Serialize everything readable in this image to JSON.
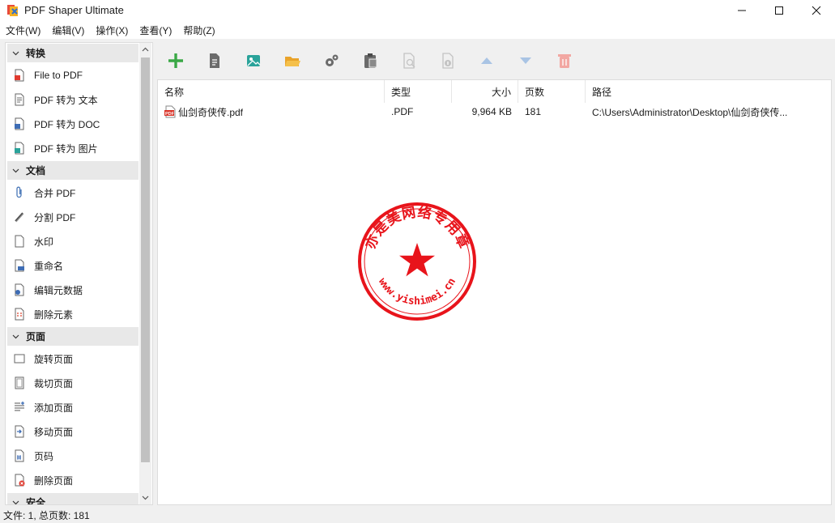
{
  "window": {
    "title": "PDF Shaper Ultimate",
    "icon": "app-icon",
    "controls": [
      "minimize-icon",
      "maximize-icon",
      "close-icon"
    ]
  },
  "menu": [
    "文件(W)",
    "编辑(V)",
    "操作(X)",
    "查看(Y)",
    "帮助(Z)"
  ],
  "sidebar": {
    "sections": [
      {
        "label": "转换",
        "items": [
          {
            "label": "File to PDF",
            "icon": "file-to-pdf-icon"
          },
          {
            "label": "PDF 转为 文本",
            "icon": "pdf-to-text-icon"
          },
          {
            "label": "PDF 转为 DOC",
            "icon": "pdf-to-doc-icon"
          },
          {
            "label": "PDF 转为 图片",
            "icon": "pdf-to-image-icon"
          }
        ]
      },
      {
        "label": "文档",
        "items": [
          {
            "label": "合并 PDF",
            "icon": "paperclip-icon"
          },
          {
            "label": "分割 PDF",
            "icon": "split-icon"
          },
          {
            "label": "水印",
            "icon": "watermark-icon"
          },
          {
            "label": "重命名",
            "icon": "rename-icon"
          },
          {
            "label": "编辑元数据",
            "icon": "metadata-icon"
          },
          {
            "label": "删除元素",
            "icon": "remove-elements-icon"
          }
        ]
      },
      {
        "label": "页面",
        "items": [
          {
            "label": "旋转页面",
            "icon": "rotate-page-icon"
          },
          {
            "label": "裁切页面",
            "icon": "crop-page-icon"
          },
          {
            "label": "添加页面",
            "icon": "add-page-icon"
          },
          {
            "label": "移动页面",
            "icon": "move-page-icon"
          },
          {
            "label": "页码",
            "icon": "page-number-icon"
          },
          {
            "label": "删除页面",
            "icon": "delete-page-icon"
          }
        ]
      },
      {
        "label": "安全",
        "items": []
      }
    ]
  },
  "toolbar": [
    "add-icon",
    "document-icon",
    "image-icon",
    "folder-open-icon",
    "settings-icon",
    "clipboard-icon",
    "search-document-icon",
    "info-icon",
    "move-up-icon",
    "move-down-icon",
    "delete-icon"
  ],
  "list": {
    "columns": [
      "名称",
      "类型",
      "大小",
      "页数",
      "路径"
    ],
    "rows": [
      {
        "name": "仙剑奇侠传.pdf",
        "type": ".PDF",
        "size": "9,964 KB",
        "pages": "181",
        "path": "C:\\Users\\Administrator\\Desktop\\仙剑奇侠传..."
      }
    ]
  },
  "stamp": {
    "top_text": "亦是美网络专用章",
    "bottom_text": "www.yishimei.cn",
    "color": "#e8141b"
  },
  "status": "文件: 1, 总页数: 181",
  "colors": {
    "accent_green": "#3aa846",
    "accent_blue": "#4a90d9",
    "stamp_red": "#e8141b"
  }
}
